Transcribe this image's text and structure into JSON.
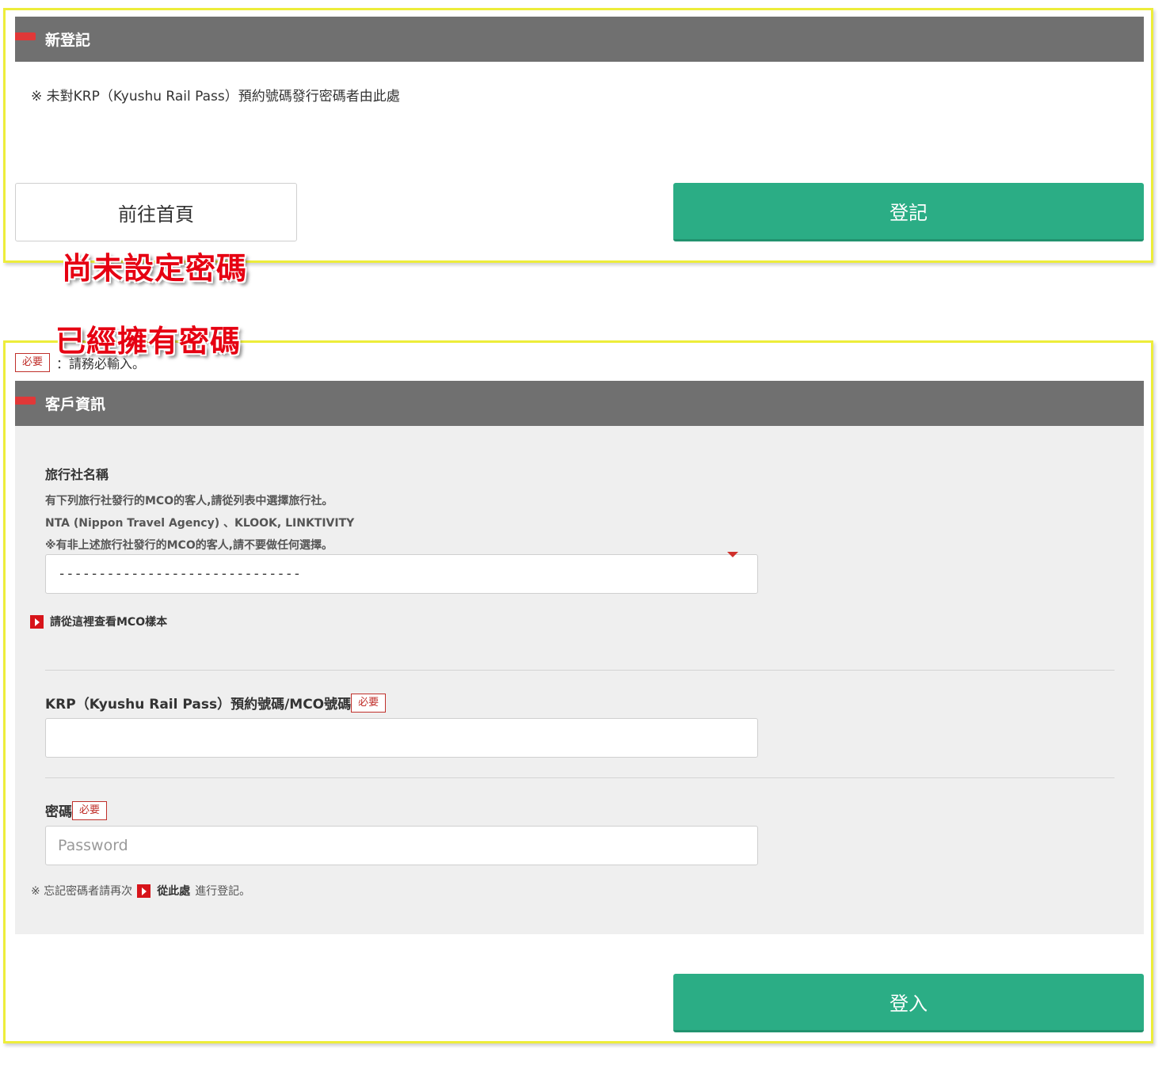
{
  "new_registration": {
    "title": "新登記",
    "note": "※ 未對KRP（Kyushu Rail Pass）預約號碼發行密碼者由此處",
    "home_button": "前往首頁",
    "register_button": "登記"
  },
  "annotations": {
    "no_password": "尚未設定密碼",
    "have_password": "已經擁有密碼"
  },
  "required_legend": {
    "badge": "必要",
    "text": "：請務必輸入。"
  },
  "customer_info": {
    "title": "客戶資訊",
    "agency": {
      "label": "旅行社名稱",
      "help1": "有下列旅行社發行的MCO的客人,請從列表中選擇旅行社。",
      "help2": "NTA (Nippon Travel Agency) 、KLOOK, LINKTIVITY",
      "help3": "※有非上述旅行社發行的MCO的客人,請不要做任何選擇。",
      "selected": "------------------------------",
      "sample_link": "請從這裡查看MCO樣本"
    },
    "reservation": {
      "label": "KRP（Kyushu Rail Pass）預約號碼/MCO號碼",
      "badge": "必要",
      "value": ""
    },
    "password": {
      "label": "密碼",
      "badge": "必要",
      "placeholder": "Password"
    },
    "forgot": {
      "prefix": "※ 忘記密碼者請再次",
      "link": "從此處",
      "suffix": "進行登記。"
    },
    "login_button": "登入"
  },
  "colors": {
    "header_bg": "#707070",
    "accent_red": "#e03838",
    "button_green": "#2bad85",
    "highlight_frame": "#eded3a",
    "panel_bg": "#efefef"
  }
}
